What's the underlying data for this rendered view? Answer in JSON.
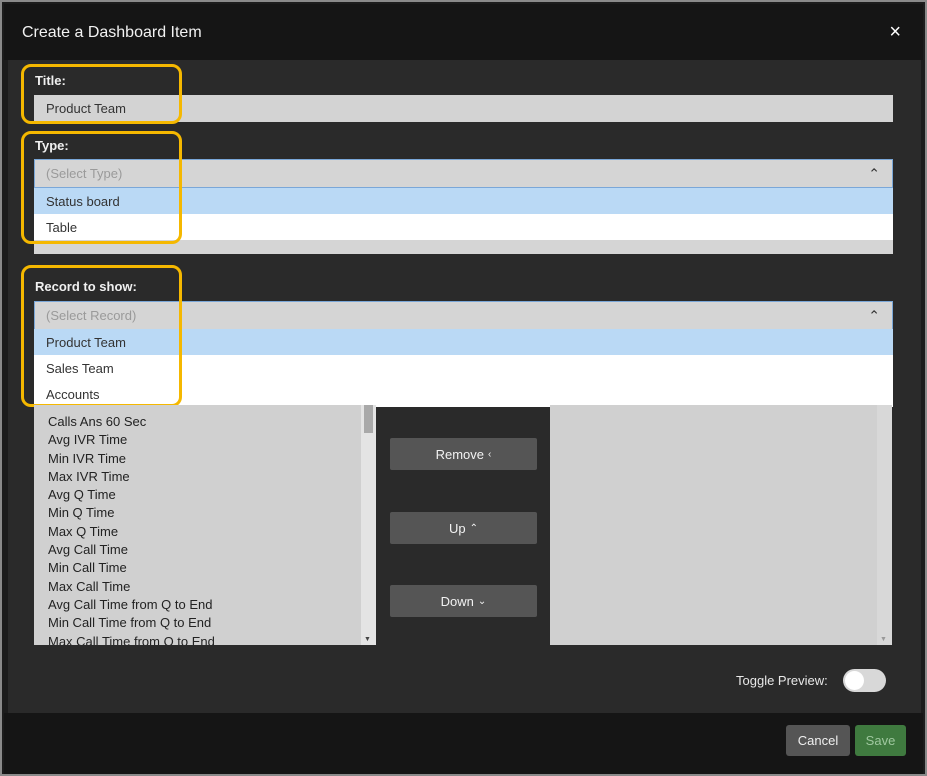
{
  "dialog": {
    "title": "Create a Dashboard Item",
    "close_icon": "close-icon",
    "close_glyph": "×"
  },
  "title_field": {
    "label": "Title:",
    "value": "Product Team"
  },
  "type_field": {
    "label": "Type:",
    "placeholder": "(Select Type)",
    "chevron_glyph": "⌃",
    "options": [
      "Status board",
      "Table"
    ],
    "highlighted_option": "Status board"
  },
  "record_field": {
    "label": "Record to show:",
    "placeholder": "(Select Record)",
    "chevron_glyph": "⌃",
    "options": [
      "Product Team",
      "Sales Team",
      "Accounts"
    ],
    "highlighted_option": "Product Team"
  },
  "available_list": {
    "items": [
      "Calls Ans 60 Sec",
      "Avg IVR Time",
      "Min IVR Time",
      "Max IVR Time",
      "Avg Q Time",
      "Min Q Time",
      "Max Q Time",
      "Avg Call Time",
      "Min Call Time",
      "Max Call Time",
      "Avg Call Time from Q to End",
      "Min Call Time from Q to End",
      "Max Call Time from Q to End"
    ]
  },
  "move_buttons": {
    "remove_label": "Remove",
    "remove_glyph": "‹",
    "up_label": "Up",
    "up_glyph": "⌃",
    "down_label": "Down",
    "down_glyph": "⌄"
  },
  "preview": {
    "label": "Toggle Preview:",
    "enabled": false
  },
  "footer": {
    "cancel_label": "Cancel",
    "save_label": "Save"
  },
  "colors": {
    "highlight": "#f5b800",
    "selected_option": "#bad9f5",
    "save_button": "#3f7a3f"
  }
}
